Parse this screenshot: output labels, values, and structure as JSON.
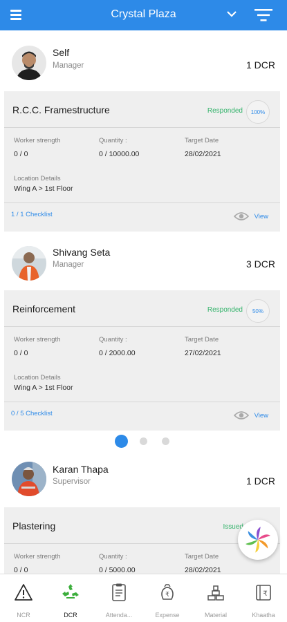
{
  "header": {
    "title": "Crystal Plaza"
  },
  "entries": [
    {
      "person": {
        "name": "Self",
        "role": "Manager",
        "dcr_count": "1 DCR"
      },
      "card": {
        "title": "R.C.C. Framestructure",
        "status": "Responded",
        "progress": "100%",
        "worker_label": "Worker strength",
        "worker_value": "0  /  0",
        "quantity_label": "Quantity :",
        "quantity_value": "0  /  10000.00",
        "target_label": "Target Date",
        "target_value": "28/02/2021",
        "location_label": "Location Details",
        "location_value": "Wing A > 1st Floor",
        "checklist": "1 / 1 Checklist",
        "view_label": "View"
      }
    },
    {
      "person": {
        "name": "Shivang Seta",
        "role": "Manager",
        "dcr_count": "3 DCR"
      },
      "card": {
        "title": "Reinforcement",
        "status": "Responded",
        "progress": "50%",
        "worker_label": "Worker strength",
        "worker_value": "0  /  0",
        "quantity_label": "Quantity :",
        "quantity_value": "0  /  2000.00",
        "target_label": "Target Date",
        "target_value": "27/02/2021",
        "location_label": "Location Details",
        "location_value": "Wing A > 1st Floor",
        "checklist": "0 / 5 Checklist",
        "view_label": "View"
      }
    },
    {
      "person": {
        "name": "Karan Thapa",
        "role": "Supervisor",
        "dcr_count": "1 DCR"
      },
      "card": {
        "title": "Plastering",
        "status": "Issued",
        "worker_label": "Worker strength",
        "worker_value": "0  /  0",
        "quantity_label": "Quantity :",
        "quantity_value": "0  /  5000.00",
        "target_label": "Target Date",
        "target_value": "28/02/2021"
      }
    }
  ],
  "pager": {
    "pages": 3,
    "active": 0
  },
  "bottom_nav": [
    {
      "label": "NCR",
      "icon": "warning-icon"
    },
    {
      "label": "DCR",
      "icon": "recycle-icon",
      "active": true
    },
    {
      "label": "Attenda...",
      "icon": "attendance-icon"
    },
    {
      "label": "Expense",
      "icon": "expense-icon"
    },
    {
      "label": "Material",
      "icon": "material-icon"
    },
    {
      "label": "Khaatha",
      "icon": "khaatha-icon"
    }
  ],
  "colors": {
    "primary": "#2d8ae8",
    "status_green": "#34b36b",
    "card_bg": "#efefef"
  }
}
